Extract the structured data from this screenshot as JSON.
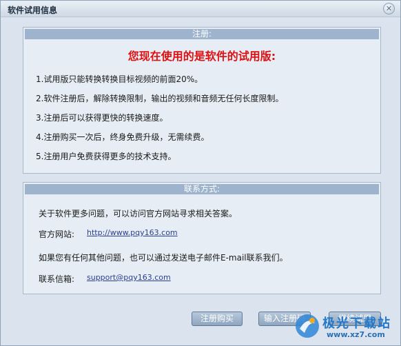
{
  "window": {
    "title": "软件试用信息",
    "close_symbol": "✕"
  },
  "registration": {
    "header": "注册:",
    "headline": "您现在使用的是软件的试用版:",
    "rules": [
      "1.试用版只能转换转换目标视频的前面20%。",
      "2.软件注册后，解除转换限制，输出的视频和音频无任何长度限制。",
      "3.注册后可以获得更快的转换速度。",
      "4.注册购买一次后，终身免费升级，无需续费。",
      "5.注册用户免费获得更多的技术支持。"
    ]
  },
  "contact": {
    "header": "联系方式:",
    "intro": "关于软件更多问题，可以访问官方网站寻求相关答案。",
    "website_label": "官方网站:",
    "website_url": "http://www.pqy163.com",
    "email_intro": "如果您有任何其他问题，也可以通过发送电子邮件E-mail联系我们。",
    "email_label": "联系信箱:",
    "email": "support@pqy163.com"
  },
  "buttons": {
    "buy": "注册购买",
    "enter_code": "输入注册码",
    "continue": "继续试用"
  },
  "watermark": {
    "brand": "极光下载站",
    "url": "www.xz7.com"
  }
}
